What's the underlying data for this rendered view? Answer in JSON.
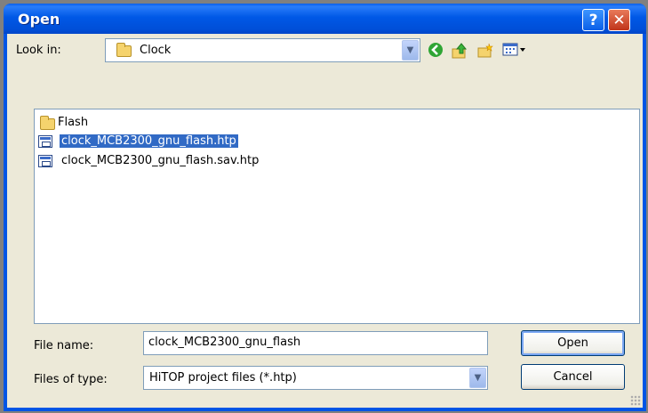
{
  "window": {
    "title": "Open"
  },
  "titlebar": {
    "help_glyph": "?",
    "close_glyph": "✕"
  },
  "lookin": {
    "label": "Look in:",
    "value": "Clock"
  },
  "toolbar": {
    "back_icon": "back-arrow-green-icon",
    "up_icon": "up-folder-icon",
    "new_folder_icon": "new-folder-icon",
    "views_icon": "view-menu-icon"
  },
  "files": [
    {
      "name": "Flash",
      "type": "folder",
      "selected": false
    },
    {
      "name": "clock_MCB2300_gnu_flash.htp",
      "type": "htp",
      "selected": true
    },
    {
      "name": "clock_MCB2300_gnu_flash.sav.htp",
      "type": "htp",
      "selected": false
    }
  ],
  "filename": {
    "label": "File name:",
    "value": "clock_MCB2300_gnu_flash"
  },
  "filetype": {
    "label": "Files of type:",
    "value": "HiTOP project files (*.htp)"
  },
  "buttons": {
    "open": "Open",
    "cancel": "Cancel"
  },
  "colors": {
    "titlebar": "#0055e5",
    "selection": "#316ac5",
    "face": "#ece9d8"
  }
}
